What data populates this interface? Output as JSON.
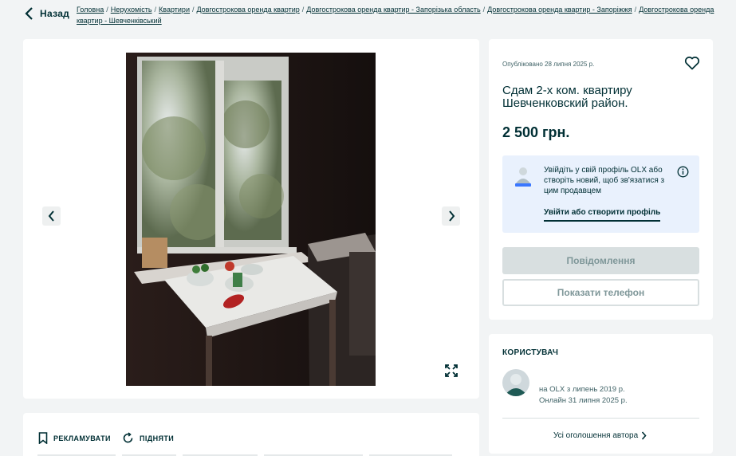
{
  "header": {
    "back_label": "Назад",
    "breadcrumbs": [
      "Головна",
      "Нерухомість",
      "Квартири",
      "Довгострокова оренда квартир",
      "Довгострокова оренда квартир - Запорізька область",
      "Довгострокова оренда квартир - Запоріжжя",
      "Довгострокова оренда квартир - Шевченківський"
    ],
    "separator": "/"
  },
  "gallery": {
    "prev_icon": "chevron-left-icon",
    "next_icon": "chevron-right-icon",
    "fullscreen_icon": "expand-icon"
  },
  "actions": {
    "promote_label": "РЕКЛАМУВАТИ",
    "raise_label": "ПІДНЯТИ"
  },
  "listing": {
    "published": "Опубліковано 28 липня 2025 р.",
    "title": "Сдам 2-х ком. квартиру Шевченковский район.",
    "price": "2 500 грн.",
    "login_prompt": "Увійдіть у свій профіль OLX або створіть новий, щоб зв'язатися з цим продавцем",
    "login_link": "Увійти або створити профіль",
    "message_button": "Повідомлення",
    "phone_button": "Показати телефон"
  },
  "user": {
    "heading": "КОРИСТУВАЧ",
    "since": "на OLX з липень 2019 р.",
    "online": "Онлайн 31 липня 2025 р.",
    "all_ads": "Усі оголошення автора"
  },
  "colors": {
    "text": "#002f34",
    "background": "#f2f4f5",
    "login_box": "#e9f1fd",
    "disabled_button": "#d8dfe0"
  }
}
